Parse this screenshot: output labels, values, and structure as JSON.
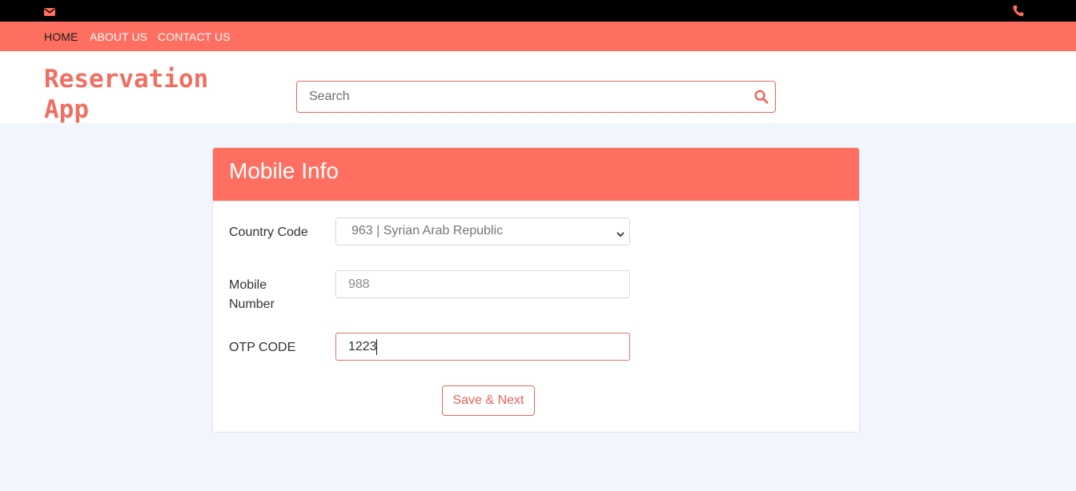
{
  "topbar": {
    "left_icon": "envelope-icon",
    "right_icon": "phone-icon",
    "icon_color": "#ff6f61"
  },
  "nav": {
    "items": [
      {
        "label": "HOME",
        "active": true
      },
      {
        "label": "ABOUT US",
        "active": false
      },
      {
        "label": "CONTACT US",
        "active": false
      }
    ]
  },
  "header": {
    "brand_line1": "Reservation",
    "brand_line2": "App",
    "search_placeholder": "Search",
    "search_icon": "search-icon"
  },
  "card": {
    "title": "Mobile Info",
    "country_code_label": "Country Code",
    "country_code_value": "963 | Syrian Arab Republic",
    "mobile_label_line1": "Mobile",
    "mobile_label_line2": "Number",
    "mobile_placeholder": "988",
    "otp_label": "OTP CODE",
    "otp_value": "1223",
    "submit_label": "Save & Next"
  },
  "colors": {
    "accent": "#ff6f61",
    "background": "#f1f5fd",
    "topbar": "#000000"
  }
}
